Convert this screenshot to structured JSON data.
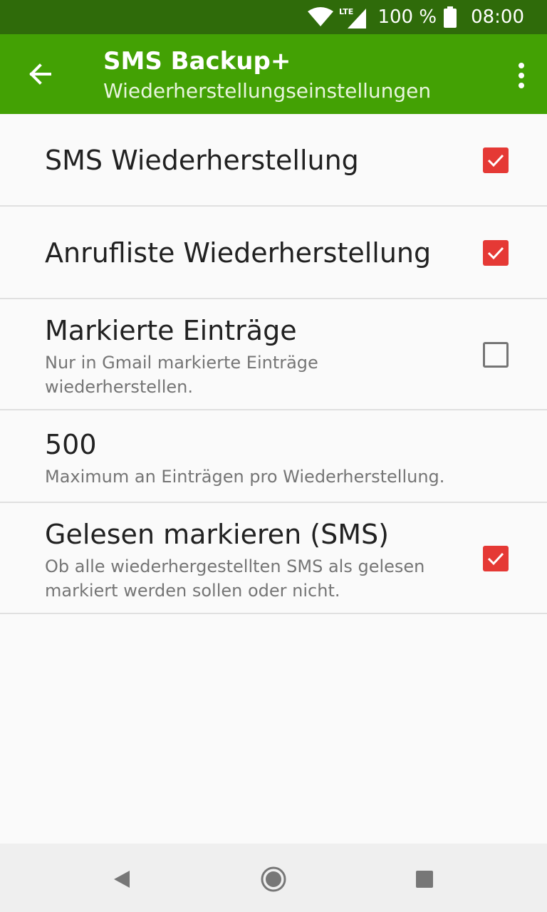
{
  "status_bar": {
    "network_label": "LTE",
    "battery_text": "100 %",
    "clock": "08:00"
  },
  "app_bar": {
    "title": "SMS Backup+",
    "subtitle": "Wiederherstellungseinstellungen",
    "color": "#43a104"
  },
  "settings": [
    {
      "title": "SMS Wiederherstellung",
      "checked": true
    },
    {
      "title": "Anrufliste Wiederherstellung",
      "checked": true
    },
    {
      "title": "Markierte Einträge",
      "summary": "Nur in Gmail markierte Einträge wiederherstellen.",
      "checked": false
    },
    {
      "title": "500",
      "summary": "Maximum an Einträgen pro Wiederherstellung."
    },
    {
      "title": "Gelesen markieren (SMS)",
      "summary": "Ob alle wiederhergestellten SMS als gelesen markiert werden sollen oder nicht.",
      "checked": true
    }
  ],
  "icons": {
    "back": "arrow-left-icon",
    "overflow": "more-vert-icon",
    "checkbox_color": "#e53935"
  }
}
